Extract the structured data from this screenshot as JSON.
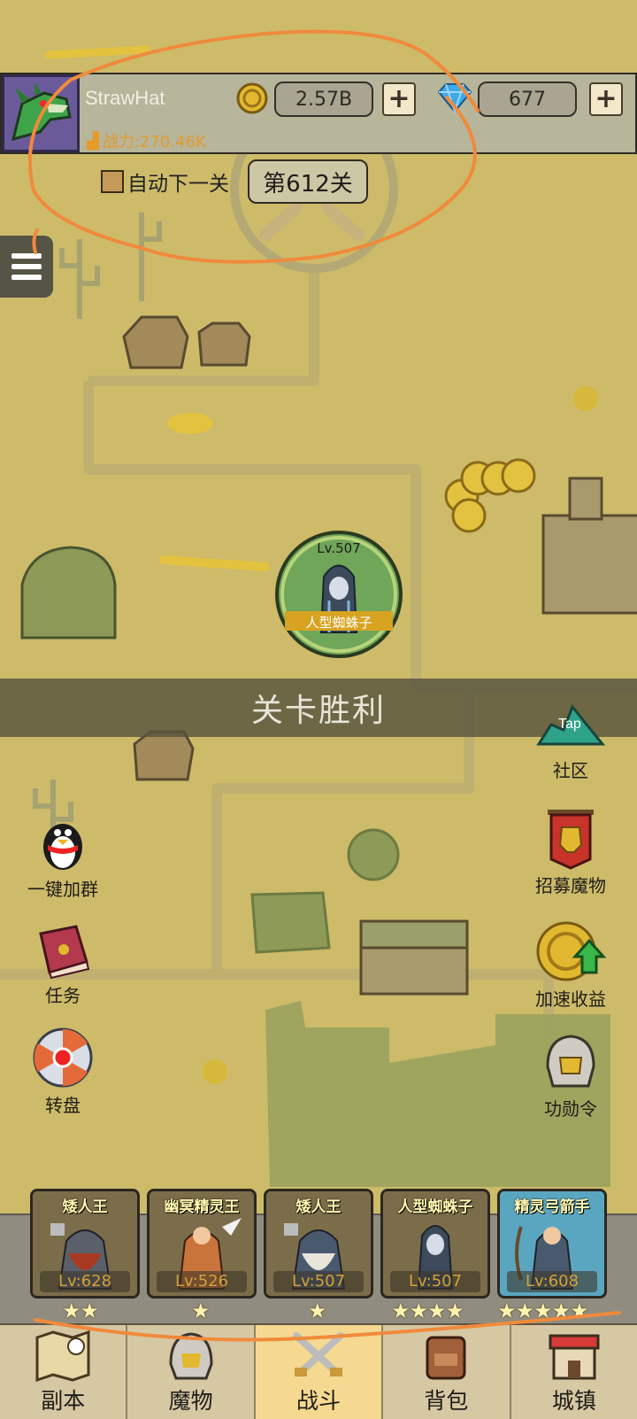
{
  "player": {
    "name": "StrawHat",
    "power_label": "战力:270.46K"
  },
  "currencies": {
    "gold": "2.57B",
    "gems": "677"
  },
  "stage": {
    "auto_next_label": "自动下一关",
    "current_stage": "第612关"
  },
  "hero": {
    "level": "Lv.507",
    "name": "人型蜘蛛子"
  },
  "banner": {
    "text": "关卡胜利"
  },
  "left_buttons": [
    {
      "label": "一键加群",
      "icon": "penguin-icon"
    },
    {
      "label": "任务",
      "icon": "quest-book-icon"
    },
    {
      "label": "转盘",
      "icon": "spin-wheel-icon"
    }
  ],
  "right_buttons": [
    {
      "label": "社区",
      "icon": "taptap-icon"
    },
    {
      "label": "招募魔物",
      "icon": "recruit-banner-icon"
    },
    {
      "label": "加速收益",
      "icon": "speed-coin-icon"
    },
    {
      "label": "功勋令",
      "icon": "helmet-icon"
    }
  ],
  "team": [
    {
      "name": "矮人王",
      "level": "Lv:628",
      "stars": 2
    },
    {
      "name": "幽冥精灵王",
      "level": "Lv:526",
      "stars": 1
    },
    {
      "name": "矮人王",
      "level": "Lv:507",
      "stars": 1
    },
    {
      "name": "人型蜘蛛子",
      "level": "Lv:507",
      "stars": 4
    },
    {
      "name": "精灵弓箭手",
      "level": "Lv:608",
      "stars": 5
    }
  ],
  "nav": [
    {
      "label": "副本",
      "icon": "map-icon",
      "active": false
    },
    {
      "label": "魔物",
      "icon": "monster-helmet-icon",
      "active": false
    },
    {
      "label": "战斗",
      "icon": "crossed-swords-icon",
      "active": true
    },
    {
      "label": "背包",
      "icon": "backpack-icon",
      "active": false
    },
    {
      "label": "城镇",
      "icon": "town-shop-icon",
      "active": false
    }
  ],
  "colors": {
    "map_bg": "#cdbb6a",
    "accent_gold": "#e59a2a",
    "active_tab": "#f5d990",
    "annotation": "#f08a3c"
  }
}
